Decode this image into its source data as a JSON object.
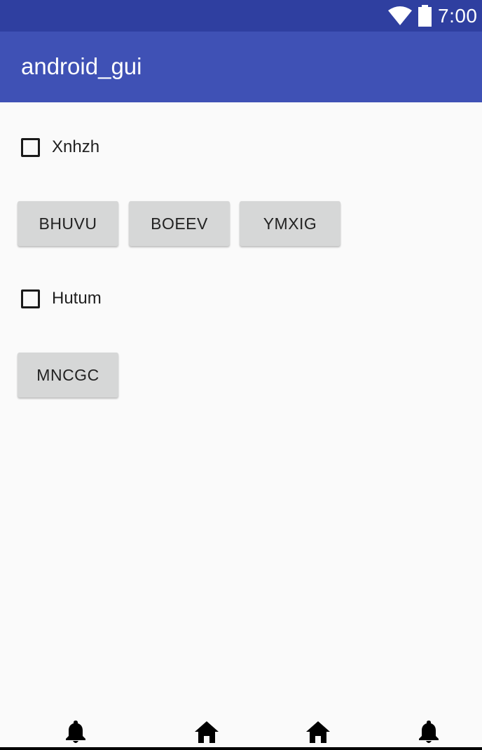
{
  "status_bar": {
    "time": "7:00",
    "icons": [
      "wifi-icon",
      "battery-icon"
    ],
    "color": "#2f3fa0"
  },
  "app_bar": {
    "title": "android_gui",
    "color": "#3f51b5"
  },
  "content": {
    "checkbox_1": {
      "label": "Xnhzh",
      "checked": false
    },
    "buttons_row_1": [
      "BHUVU",
      "BOEEV",
      "YMXIG"
    ],
    "checkbox_2": {
      "label": "Hutum",
      "checked": false
    },
    "button_row_2": "MNCGC"
  },
  "bottom_nav": {
    "icons": [
      "bell-icon",
      "home-icon",
      "home-icon",
      "bell-icon"
    ]
  },
  "colors": {
    "background": "#fafafa",
    "button": "#d6d7d7",
    "text": "#222222"
  }
}
